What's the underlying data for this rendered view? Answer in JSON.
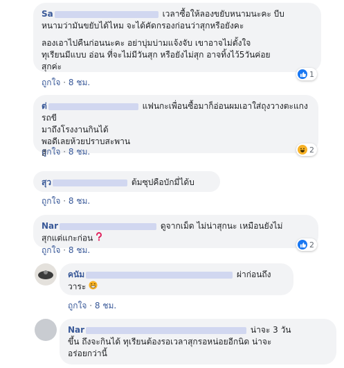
{
  "comments": [
    {
      "name": "Sa",
      "lines": [
        "เวลาซื้อให้ลองขยับหนามนะคะ บีบ",
        "หนามว่ามันขยับได้ไหม จะได้คัดกรองก่อนว่าสุกหรือยังคะ",
        "",
        "ลองเอาไปคืนก่อนนะคะ อย่าบุ่มบ่ามแจ้งจับ เขาอาจไม่ตั้งใจ",
        "ทุเรียนมีแบบ อ่อน ที่จะไม่มีวันสุก หรือยังไม่สุก อาจทิ้งไว้5วันค่อย",
        "สุกค่ะ"
      ],
      "like": "ถูกใจ",
      "time": "8 ชม.",
      "reaction_count": "1"
    },
    {
      "name": "ต่",
      "lines": [
        "แฟนกะเพื่อนซื้อมาก็อ่อนผมเอาใส่ถุงวางตะแกงรถขี",
        "มาถึงโรงงานกินได้",
        "พอดีเลยห้วยปราบสะพาน",
        "สี"
      ],
      "like": "ถูกใจ",
      "time": "8 ชม.",
      "reaction_count": "2"
    },
    {
      "name": "สุว",
      "lines": [
        "ต้มซุปคือบักมี่ได้บ"
      ],
      "like": "ถูกใจ",
      "time": "8 ชม."
    },
    {
      "name": "Nar",
      "lines": [
        "ดูจากเม็ด ไม่น่าสุกนะ เหมือนยังไม่",
        "สุกแต่แกะก่อน"
      ],
      "like": "ถูกใจ",
      "time": "8 ชม.",
      "reaction_count": "2"
    },
    {
      "name": "คนัม",
      "lines": [
        "ผ่าก่อนถึง",
        "วาระ"
      ],
      "like": "ถูกใจ",
      "time": "8 ชม."
    },
    {
      "name": "Nar",
      "lines": [
        "น่าจะ 3 วัน",
        "ขึ้น ถึงจะกินได้ ทุเรียนต้องรอเวลาสุกรอหน่อยอีกนิด น่าจะ",
        "อร่อยกว่านี้"
      ],
      "like": "ถูกใจ",
      "time": "8 ชม."
    }
  ]
}
